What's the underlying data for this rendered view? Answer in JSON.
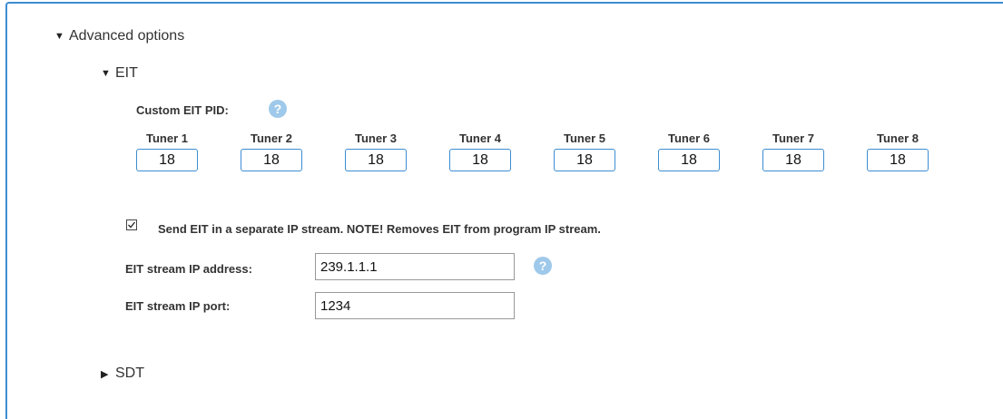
{
  "advanced_options": {
    "label": "Advanced options",
    "expanded": true,
    "toggle_icon": "triangle-down-icon"
  },
  "eit": {
    "label": "EIT",
    "expanded": true,
    "toggle_icon": "triangle-down-icon",
    "custom_pid_label": "Custom EIT PID:",
    "help_icon": "?",
    "tuners": [
      {
        "label": "Tuner 1",
        "value": "18"
      },
      {
        "label": "Tuner 2",
        "value": "18"
      },
      {
        "label": "Tuner 3",
        "value": "18"
      },
      {
        "label": "Tuner 4",
        "value": "18"
      },
      {
        "label": "Tuner 5",
        "value": "18"
      },
      {
        "label": "Tuner 6",
        "value": "18"
      },
      {
        "label": "Tuner 7",
        "value": "18"
      },
      {
        "label": "Tuner 8",
        "value": "18"
      }
    ],
    "separate_stream": {
      "checked": true,
      "label": "Send EIT in a separate IP stream. NOTE! Removes EIT from program IP stream."
    },
    "ip_address": {
      "label": "EIT stream IP address:",
      "value": "239.1.1.1"
    },
    "ip_port": {
      "label": "EIT stream IP port:",
      "value": "1234"
    }
  },
  "sdt": {
    "label": "SDT",
    "expanded": false,
    "toggle_icon": "triangle-right-icon"
  },
  "colors": {
    "accent": "#3c8dd2",
    "help_icon": "#9fc9ea",
    "text": "#333333"
  }
}
